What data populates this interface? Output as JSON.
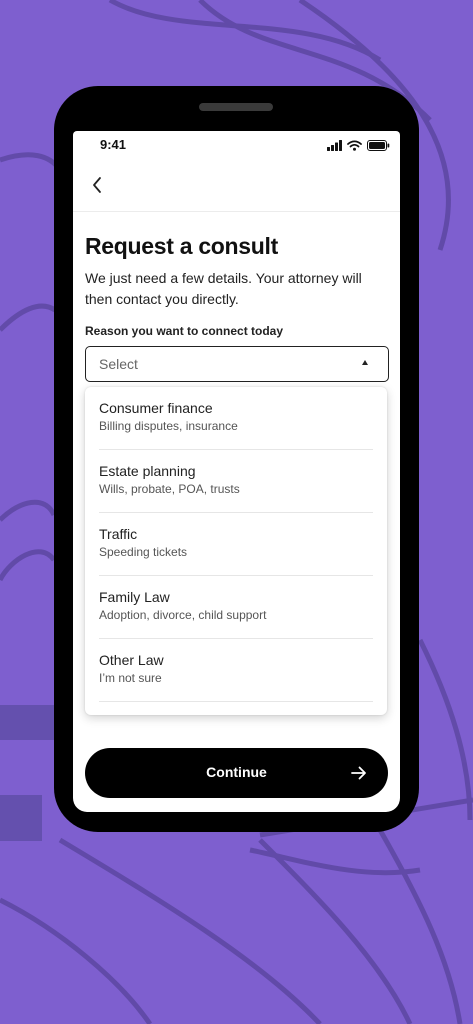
{
  "status_bar": {
    "time": "9:41"
  },
  "page": {
    "title": "Request a consult",
    "subtitle": "We just need a few details. Your attorney will then contact you directly."
  },
  "form": {
    "reason_label": "Reason you want to connect today",
    "select_value": "Select"
  },
  "options": [
    {
      "title": "Consumer finance",
      "description": "Billing disputes, insurance"
    },
    {
      "title": "Estate planning",
      "description": "Wills, probate, POA, trusts"
    },
    {
      "title": "Traffic",
      "description": "Speeding tickets"
    },
    {
      "title": "Family Law",
      "description": "Adoption, divorce, child support"
    },
    {
      "title": "Other Law",
      "description": "I’m not sure"
    }
  ],
  "actions": {
    "continue_label": "Continue"
  },
  "icons": {
    "back": "chevron-left-icon",
    "caret": "caret-up-icon",
    "continue": "arrow-right-icon",
    "signal": "signal-icon",
    "wifi": "wifi-icon",
    "battery": "battery-icon"
  },
  "colors": {
    "background": "#7e5fcf",
    "accent": "#000000",
    "surface": "#ffffff"
  }
}
